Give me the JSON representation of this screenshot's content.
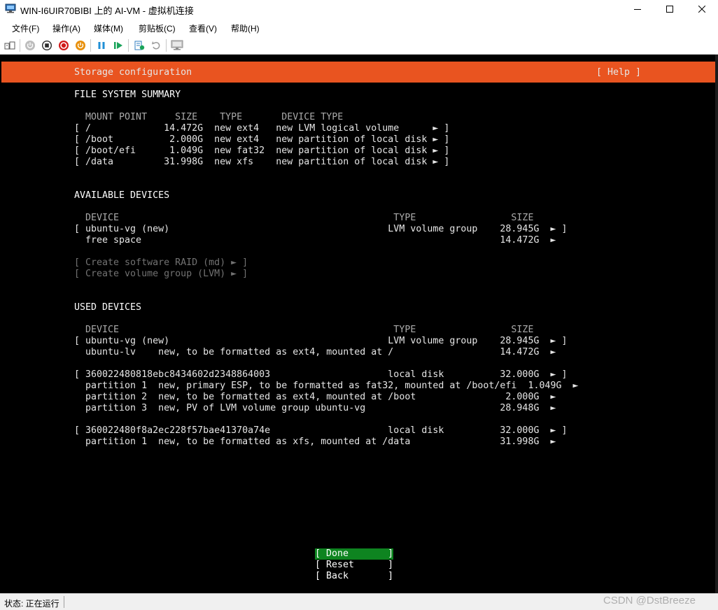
{
  "window": {
    "title": "WIN-I6UIR70BIBI 上的 AI-VM - 虚拟机连接",
    "menu": [
      "文件(F)",
      "操作(A)",
      "媒体(M)",
      "剪贴板(C)",
      "查看(V)",
      "帮助(H)"
    ]
  },
  "toolbar": {
    "icons": [
      "ctrl-alt-del-icon",
      "start-icon",
      "turn-off-icon",
      "shutdown-icon",
      "power-icon",
      "pause-icon",
      "resume-icon",
      "checkpoint-icon",
      "revert-icon",
      "enhanced-session-icon"
    ]
  },
  "header": {
    "title": "Storage configuration",
    "help": "[ Help ]"
  },
  "fs_summary": {
    "heading": "FILE SYSTEM SUMMARY",
    "header_row": "  MOUNT POINT     SIZE    TYPE       DEVICE TYPE",
    "rows": [
      "[ /             14.472G  new ext4   new LVM logical volume      ► ]",
      "[ /boot          2.000G  new ext4   new partition of local disk ► ]",
      "[ /boot/efi      1.049G  new fat32  new partition of local disk ► ]",
      "[ /data         31.998G  new xfs    new partition of local disk ► ]"
    ]
  },
  "available": {
    "heading": "AVAILABLE DEVICES",
    "header_row": "  DEVICE                                                 TYPE                 SIZE",
    "rows": [
      "[ ubuntu-vg (new)                                       LVM volume group    28.945G  ► ]",
      "  free space                                                                14.472G  ►"
    ],
    "actions": [
      "[ Create software RAID (md) ► ]",
      "[ Create volume group (LVM) ► ]"
    ]
  },
  "used": {
    "heading": "USED DEVICES",
    "header_row": "  DEVICE                                                 TYPE                 SIZE",
    "groups": [
      [
        "[ ubuntu-vg (new)                                       LVM volume group    28.945G  ► ]",
        "  ubuntu-lv    new, to be formatted as ext4, mounted at /                   14.472G  ►"
      ],
      [
        "[ 360022480818ebc8434602d2348864003                     local disk          32.000G  ► ]",
        "  partition 1  new, primary ESP, to be formatted as fat32, mounted at /boot/efi  1.049G  ►",
        "  partition 2  new, to be formatted as ext4, mounted at /boot                2.000G  ►",
        "  partition 3  new, PV of LVM volume group ubuntu-vg                        28.948G  ►"
      ],
      [
        "[ 360022480f8a2ec228f57bae41370a74e                     local disk          32.000G  ► ]",
        "  partition 1  new, to be formatted as xfs, mounted at /data                31.998G  ►"
      ]
    ]
  },
  "buttons": {
    "done": "[ Done       ]",
    "reset": "[ Reset      ]",
    "back": "[ Back       ]"
  },
  "status": {
    "text": "状态: 正在运行"
  },
  "watermark": "CSDN @DstBreeze",
  "colors": {
    "header_bg": "#e95420",
    "done_bg": "#0e8420",
    "console_bg": "#000000"
  }
}
